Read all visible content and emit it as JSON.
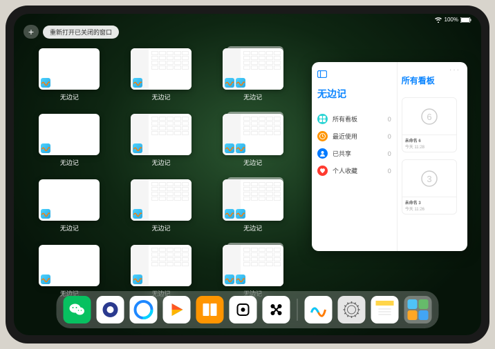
{
  "status": {
    "battery_text": "100%"
  },
  "top": {
    "plus": "+",
    "reopen_label": "重新打开已关闭的窗口"
  },
  "windows": [
    {
      "label": "无边记",
      "variant": "blank"
    },
    {
      "label": "无边记",
      "variant": "cal"
    },
    {
      "label": "无边记",
      "variant": "cal-stack"
    },
    {
      "label": "无边记",
      "variant": "blank"
    },
    {
      "label": "无边记",
      "variant": "cal"
    },
    {
      "label": "无边记",
      "variant": "cal-stack"
    },
    {
      "label": "无边记",
      "variant": "blank"
    },
    {
      "label": "无边记",
      "variant": "cal"
    },
    {
      "label": "无边记",
      "variant": "cal-stack"
    },
    {
      "label": "无边记",
      "variant": "blank"
    },
    {
      "label": "无边记",
      "variant": "cal"
    },
    {
      "label": "无边记",
      "variant": "cal-stack"
    }
  ],
  "panel": {
    "left_title": "无边记",
    "categories": [
      {
        "label": "所有看板",
        "count": "0",
        "color": "cyan",
        "icon": "grid"
      },
      {
        "label": "最近使用",
        "count": "0",
        "color": "orange",
        "icon": "clock"
      },
      {
        "label": "已共享",
        "count": "0",
        "color": "blue",
        "icon": "person"
      },
      {
        "label": "个人收藏",
        "count": "0",
        "color": "red",
        "icon": "heart"
      }
    ],
    "right_title": "所有看板",
    "boards": [
      {
        "name": "未命名 6",
        "time": "今天 11:28",
        "sketch": "6"
      },
      {
        "name": "未命名 3",
        "time": "今天 11:26",
        "sketch": "3"
      }
    ]
  },
  "dock": {
    "apps": [
      {
        "name": "wechat",
        "bg": "#07c160"
      },
      {
        "name": "quark",
        "bg": "#ffffff"
      },
      {
        "name": "qq-browser",
        "bg": "#ffffff"
      },
      {
        "name": "video",
        "bg": "#ffffff"
      },
      {
        "name": "books",
        "bg": "#ff9500"
      },
      {
        "name": "dice",
        "bg": "#ffffff"
      },
      {
        "name": "connect",
        "bg": "#ffffff"
      }
    ],
    "recents": [
      {
        "name": "freeform",
        "bg": "#ffffff"
      },
      {
        "name": "settings",
        "bg": "#e5e5e5"
      },
      {
        "name": "notes",
        "bg": "#ffffff"
      }
    ]
  }
}
